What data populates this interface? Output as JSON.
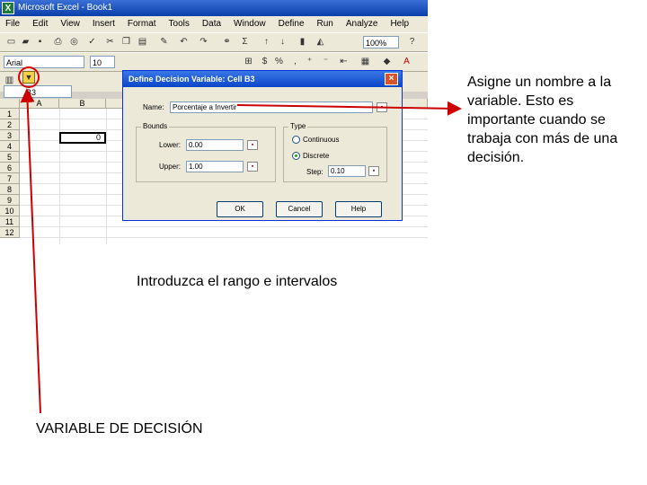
{
  "window": {
    "app_title": "Microsoft Excel - Book1",
    "app_icon": "excel-icon"
  },
  "menu": [
    "File",
    "Edit",
    "View",
    "Insert",
    "Format",
    "Tools",
    "Data",
    "Window",
    "Define",
    "Run",
    "Analyze",
    "Help"
  ],
  "toolbar": {
    "zoom": "100%",
    "font": "Arial",
    "font_size": "10"
  },
  "name_box": "B3",
  "sheet": {
    "columns": [
      "A",
      "B"
    ],
    "rows": [
      "1",
      "2",
      "3",
      "4",
      "5",
      "6",
      "7",
      "8",
      "9",
      "10",
      "11",
      "12"
    ],
    "active_cell_value": "0"
  },
  "dialog": {
    "title": "Define Decision Variable: Cell B3",
    "name_label": "Name:",
    "name_value": "Porcentaje a Invertir",
    "bounds_label": "Bounds",
    "lower_label": "Lower:",
    "lower_value": "0.00",
    "upper_label": "Upper:",
    "upper_value": "1.00",
    "type_label": "Type",
    "continuous_label": "Continuous",
    "discrete_label": "Discrete",
    "selected_type": "Discrete",
    "step_label": "Step:",
    "step_value": "0.10",
    "ok_label": "OK",
    "cancel_label": "Cancel",
    "help_label": "Help"
  },
  "annotations": {
    "right_note": "Asigne un nombre a la variable. Esto es importante cuando se trabaja con más de una decisión.",
    "middle_note": "Introduzca el rango e intervalos",
    "bottom_note": "VARIABLE DE DECISIÓN"
  },
  "colors": {
    "arrow": "#cc0000",
    "titlebar": "#0a3ea8",
    "dialog_title": "#0a45c8"
  }
}
